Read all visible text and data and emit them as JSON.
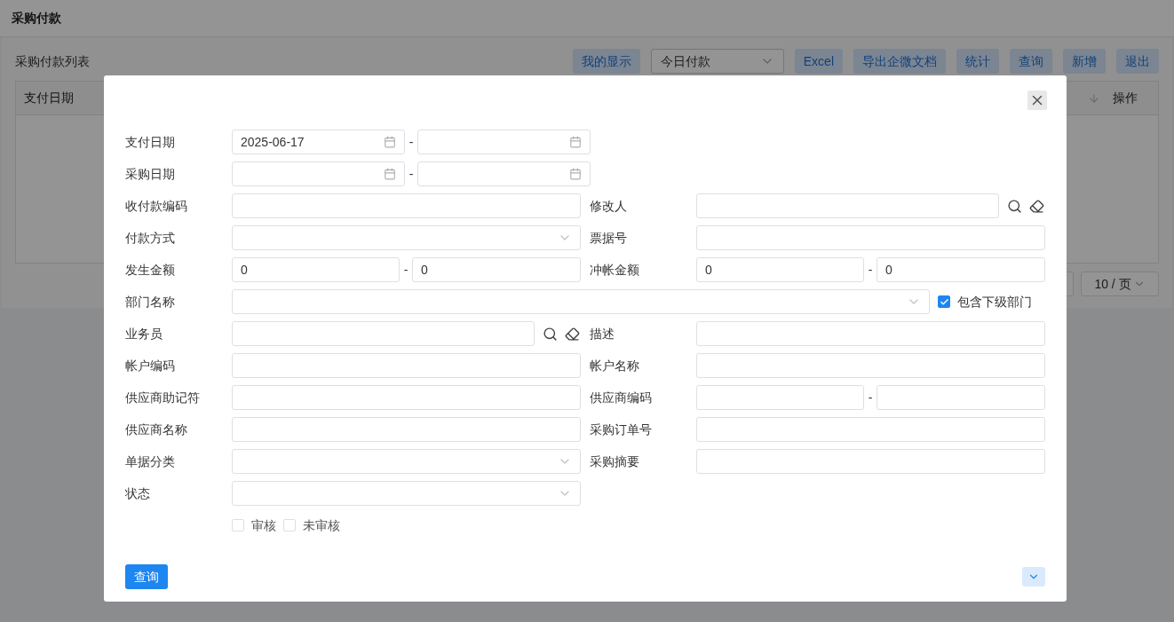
{
  "page": {
    "title": "采购付款",
    "list_title": "采购付款列表"
  },
  "toolbar": [
    {
      "kind": "button",
      "label": "我的显示"
    },
    {
      "kind": "select",
      "value": "今日付款"
    },
    {
      "kind": "button",
      "label": "Excel"
    },
    {
      "kind": "button",
      "label": "导出企微文档"
    },
    {
      "kind": "button",
      "label": "统计"
    },
    {
      "kind": "button",
      "label": "查询"
    },
    {
      "kind": "button",
      "label": "新增"
    },
    {
      "kind": "button",
      "label": "退出"
    }
  ],
  "table": {
    "columns": [
      "支付日期",
      "操作"
    ]
  },
  "pagination": {
    "page_size": "10 / 页"
  },
  "dialog": {
    "rows": [
      [
        {
          "kind": "date_range",
          "label": "支付日期",
          "from": "2025-06-17",
          "separator": "-"
        }
      ],
      [
        {
          "kind": "date_range",
          "label": "采购日期",
          "separator": "-"
        }
      ],
      [
        {
          "kind": "text",
          "label": "收付款编码"
        },
        {
          "kind": "lookup",
          "label": "修改人"
        }
      ],
      [
        {
          "kind": "select",
          "label": "付款方式"
        },
        {
          "kind": "text",
          "label": "票据号"
        }
      ],
      [
        {
          "kind": "range",
          "label": "发生金额",
          "from": "0",
          "to": "0",
          "separator": "-"
        },
        {
          "kind": "range",
          "label": "冲帐金额",
          "from": "0",
          "to": "0",
          "separator": "-"
        }
      ],
      [
        {
          "kind": "select_wide",
          "label": "部门名称",
          "option": {
            "label": "包含下级部门",
            "checked": true
          }
        }
      ],
      [
        {
          "kind": "lookup",
          "label": "业务员"
        },
        {
          "kind": "text",
          "label": "描述"
        }
      ],
      [
        {
          "kind": "text",
          "label": "帐户编码"
        },
        {
          "kind": "text",
          "label": "帐户名称"
        }
      ],
      [
        {
          "kind": "text",
          "label": "供应商助记符"
        },
        {
          "kind": "range",
          "label": "供应商编码",
          "separator": "-"
        }
      ],
      [
        {
          "kind": "text",
          "label": "供应商名称"
        },
        {
          "kind": "text",
          "label": "采购订单号"
        }
      ],
      [
        {
          "kind": "select",
          "label": "单据分类"
        },
        {
          "kind": "text",
          "label": "采购摘要"
        }
      ],
      [
        {
          "kind": "select",
          "label": "状态"
        }
      ],
      [
        {
          "kind": "checks",
          "options": [
            {
              "label": "审核",
              "checked": false
            },
            {
              "label": "未审核",
              "checked": false
            }
          ]
        }
      ]
    ],
    "submit": "查询"
  }
}
